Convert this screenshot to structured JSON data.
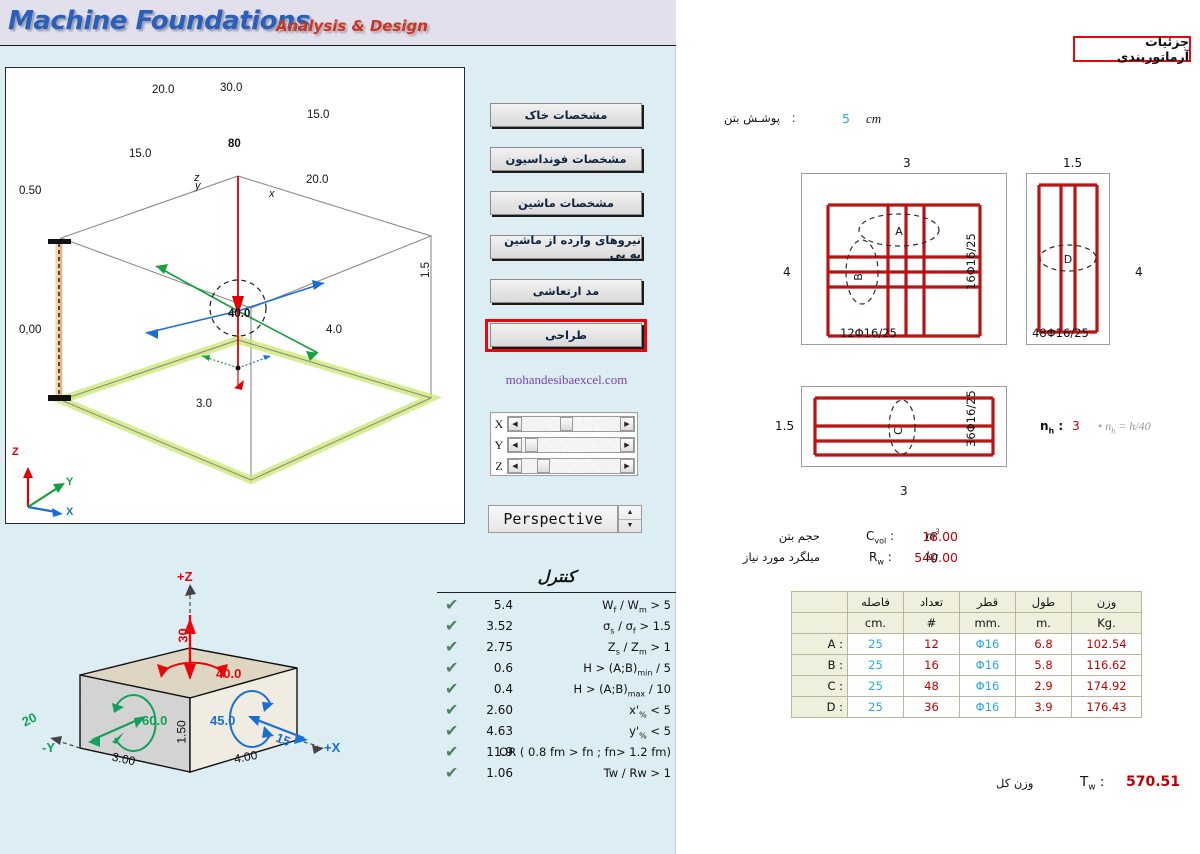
{
  "header": {
    "title_main": "Machine Foundations",
    "title_sub": "Analysis & Design"
  },
  "sidebar": {
    "buttons": [
      {
        "label": "مشخصات خاک",
        "name": "soil-properties"
      },
      {
        "label": "مشخصات فونداسیون",
        "name": "foundation-properties"
      },
      {
        "label": "مشخصات ماشین",
        "name": "machine-properties"
      },
      {
        "label": "نیروهای وارده از ماشین به پی",
        "name": "machine-loads"
      },
      {
        "label": "مد ارتعاشی",
        "name": "vibration-mode"
      },
      {
        "label": "طراحی",
        "name": "design"
      }
    ],
    "selected_button": "طراحی",
    "site_link": "mohandesibaexcel.com",
    "axis_scrolls": [
      {
        "label": "X",
        "thumb_pct": 0.4
      },
      {
        "label": "Y",
        "thumb_pct": 0.14
      },
      {
        "label": "Z",
        "thumb_pct": 0.24
      }
    ],
    "view_mode": "Perspective"
  },
  "viewport": {
    "elevation_top": "0.50",
    "elevation_bottom": "0,00",
    "dim_depth_top": "30.0",
    "force_moment_center": "80",
    "arrows": [
      {
        "label": "20.0",
        "color": "#14a03c"
      },
      {
        "label": "15.0",
        "color": "#1a6fd4"
      },
      {
        "label": "15.0",
        "color": "#1a6fd4"
      },
      {
        "label": "20.0",
        "color": "#14a03c"
      },
      {
        "label": "30.0",
        "color": "#e00000"
      }
    ],
    "base_label": "40.0",
    "dim_x": "4.0",
    "dim_y": "3.0",
    "dim_h": "1.5",
    "axis_labels_small": {
      "x": "x",
      "y": "y",
      "z": "z"
    },
    "axes_triad": {
      "z": "Z",
      "y": "Y",
      "x": "X"
    }
  },
  "block3d": {
    "axis_pz": "+Z",
    "axis_nx": "+X",
    "axis_ny": "-Y",
    "force_z": "30",
    "moment_z": "40.0",
    "force_y": "20",
    "moment_y": "60.0",
    "force_x": "15",
    "moment_x": "45.0",
    "dim_a": "3.00",
    "dim_b": "4.00",
    "dim_h": "1.50"
  },
  "control": {
    "title": "کنترل",
    "rows": [
      {
        "value": "5.4",
        "criterion": "W_f / W_m > 5",
        "ok": true
      },
      {
        "value": "3.52",
        "criterion": "σ_s / σ_f > 1.5",
        "ok": true
      },
      {
        "value": "2.75",
        "criterion": "Z_s / Z_m > 1",
        "ok": true
      },
      {
        "value": "0.6",
        "criterion": "H > (A;B)_min / 5",
        "ok": true
      },
      {
        "value": "0.4",
        "criterion": "H > (A;B)_max / 10",
        "ok": true
      },
      {
        "value": "2.60",
        "criterion": "x'_% < 5",
        "ok": true
      },
      {
        "value": "4.63",
        "criterion": "y'_% < 5",
        "ok": true
      },
      {
        "value": "11.9",
        "criterion": "OR ( 0.8 fm > fn ;  fn> 1.2 fm)",
        "ok": true
      },
      {
        "value": "1.06",
        "criterion": "Tw / Rw > 1",
        "ok": true
      }
    ],
    "check_glyph": "✔"
  },
  "rebar": {
    "header": "جزئیات آرماتوربندی",
    "cover_label": "پوشـش بتن",
    "cover_colon": ":",
    "cover_value": "5",
    "cover_unit": "cm",
    "diagrams": [
      {
        "name": "plan-view",
        "top_dim": "3",
        "side_dim": "4",
        "bottom_caption": "12Φ16/25",
        "right_caption": "16Φ16/25",
        "bubbles": [
          "A",
          "B"
        ]
      },
      {
        "name": "section-right",
        "top_dim": "1.5",
        "side_dim": "4",
        "bottom_caption": "48Φ16/25",
        "bubbles": [
          "D"
        ]
      },
      {
        "name": "section-bottom",
        "top_dim": "1.5",
        "bottom_dim": "3",
        "right_caption": "36Φ16/25",
        "bubbles": [
          "C"
        ]
      }
    ],
    "nh_label": "n_h :",
    "nh_value": "3",
    "nh_note": "• n_h = h/40",
    "summary": [
      {
        "fa": "حجم بتن",
        "sym": "C_vol :",
        "value": "18.00",
        "unit": "m³"
      },
      {
        "fa": "میلگرد مورد نیاز",
        "sym": "R_w :",
        "value": "540.00",
        "unit": "kg"
      }
    ],
    "table": {
      "headers_fa": [
        "",
        "فاصله",
        "تعداد",
        "قطر",
        "طول",
        "وزن"
      ],
      "headers_unit": [
        "",
        "cm.",
        "#",
        "mm.",
        "m.",
        "Kg."
      ],
      "rows": [
        {
          "label": "A :",
          "spacing": "25",
          "count": "12",
          "diameter": "Φ16",
          "length": "6.8",
          "weight": "102.54"
        },
        {
          "label": "B :",
          "spacing": "25",
          "count": "16",
          "diameter": "Φ16",
          "length": "5.8",
          "weight": "116.62"
        },
        {
          "label": "C :",
          "spacing": "25",
          "count": "48",
          "diameter": "Φ16",
          "length": "2.9",
          "weight": "174.92"
        },
        {
          "label": "D :",
          "spacing": "25",
          "count": "36",
          "diameter": "Φ16",
          "length": "3.9",
          "weight": "176.43"
        }
      ]
    },
    "total": {
      "fa": "وزن کل",
      "sym": "T_w :",
      "value": "570.51"
    }
  },
  "colors": {
    "panel_bg": "#dceef4",
    "header_bg": "#e3e0ee",
    "accent_red": "#e8070a",
    "value_red": "#c00000",
    "value_blue": "#29a8e0",
    "rebar_red": "#b81414",
    "table_header_bg": "#eef0dd",
    "green_arrow": "#14a03c",
    "blue_arrow": "#1a6fd4",
    "link_purple": "#7d3fb0"
  }
}
